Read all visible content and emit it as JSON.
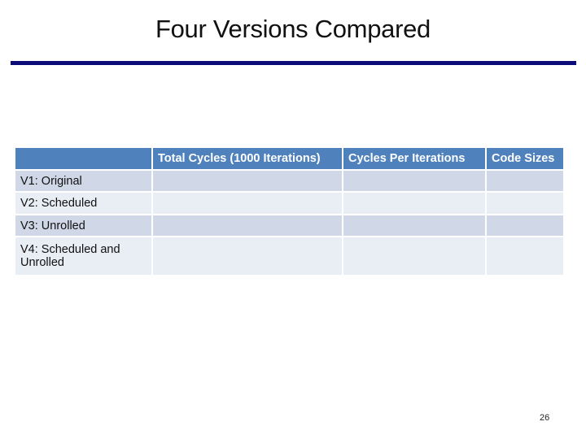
{
  "slide": {
    "title": "Four Versions Compared",
    "page_number": "26",
    "accent_color": "#0b0b7a",
    "header_color": "#4f81bd"
  },
  "table": {
    "headers": [
      "",
      "Total Cycles (1000 Iterations)",
      "Cycles Per Iterations",
      "Code Sizes"
    ],
    "rows": [
      {
        "label": "V1: Original",
        "cells": [
          "",
          "",
          ""
        ]
      },
      {
        "label": "V2: Scheduled",
        "cells": [
          "",
          "",
          ""
        ]
      },
      {
        "label": "V3: Unrolled",
        "cells": [
          "",
          "",
          ""
        ]
      },
      {
        "label": "V4: Scheduled and Unrolled",
        "cells": [
          "",
          "",
          ""
        ]
      }
    ]
  }
}
